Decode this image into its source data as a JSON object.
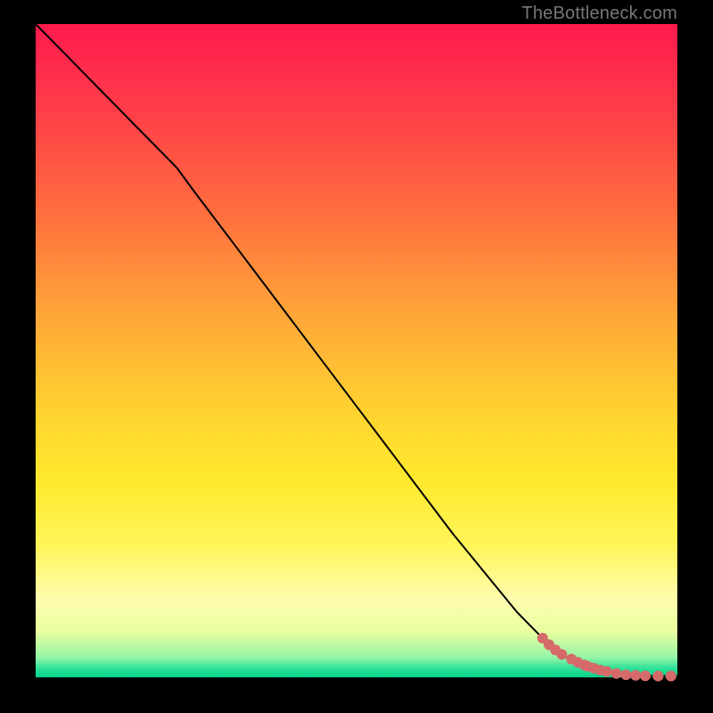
{
  "source_label": "TheBottleneck.com",
  "colors": {
    "top": "#ff1a4d",
    "mid": "#ffe92e",
    "bottom": "#02d18b",
    "curve": "#000000",
    "points": "#d66a6a",
    "frame": "#000000"
  },
  "chart_data": {
    "type": "line",
    "title": "",
    "xlabel": "",
    "ylabel": "",
    "xlim": [
      0,
      100
    ],
    "ylim": [
      0,
      100
    ],
    "grid": false,
    "legend": false,
    "series": [
      {
        "name": "curve",
        "x": [
          0,
          5,
          10,
          15,
          20,
          22,
          25,
          30,
          35,
          40,
          45,
          50,
          55,
          60,
          65,
          70,
          75,
          80,
          82,
          84,
          86,
          88,
          90,
          92,
          94,
          96,
          98,
          100
        ],
        "y": [
          100,
          95,
          90,
          85,
          80,
          78,
          74,
          67.5,
          61,
          54.5,
          48,
          41.5,
          35,
          28.5,
          22,
          16,
          10,
          5,
          3.5,
          2.4,
          1.6,
          1.0,
          0.6,
          0.4,
          0.3,
          0.2,
          0.2,
          0.2
        ]
      }
    ],
    "points": {
      "name": "markers",
      "x": [
        79,
        80,
        81,
        82,
        83.5,
        84.5,
        85.5,
        86,
        87,
        88,
        89,
        90.5,
        92,
        93.5,
        95,
        97,
        99
      ],
      "y": [
        6.0,
        5.0,
        4.2,
        3.5,
        2.8,
        2.3,
        1.9,
        1.7,
        1.4,
        1.1,
        0.9,
        0.6,
        0.4,
        0.3,
        0.25,
        0.2,
        0.2
      ]
    }
  }
}
